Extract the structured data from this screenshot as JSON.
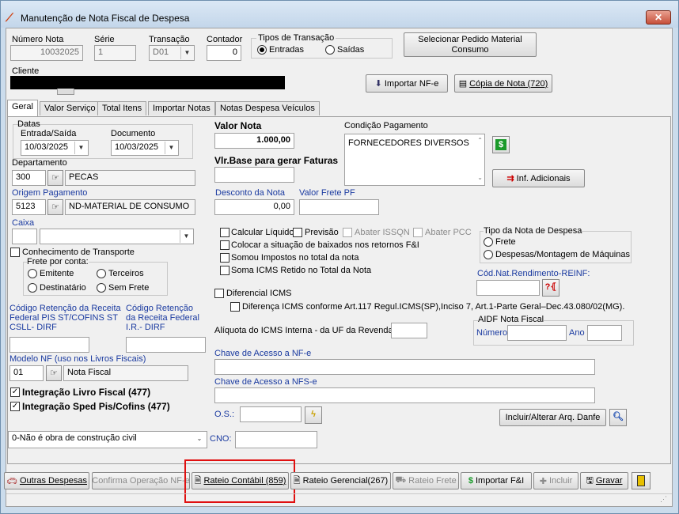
{
  "window": {
    "title": "Manutenção de Nota Fiscal de Despesa",
    "close": "✕"
  },
  "header": {
    "numero_nota_label": "Número Nota",
    "numero_nota": "10032025",
    "serie_label": "Série",
    "serie": "1",
    "transacao_label": "Transação",
    "transacao": "D01",
    "contador_label": "Contador",
    "contador": "0",
    "tipos_label": "Tipos de Transação",
    "entradas": "Entradas",
    "saidas": "Saídas",
    "selecionar_pedido": "Selecionar Pedido Material Consumo",
    "cliente_label": "Cliente",
    "importar_nfe": "Importar NF-e",
    "copia_nota": "Cópia de Nota (720)"
  },
  "tabs": [
    "Geral",
    "Valor Serviço",
    "Total Itens",
    "Importar Notas",
    "Notas Despesa Veículos"
  ],
  "geral": {
    "datas_label": "Datas",
    "entrada_saida_label": "Entrada/Saída",
    "entrada_saida": "10/03/2025",
    "documento_label": "Documento",
    "documento": "10/03/2025",
    "departamento_label": "Departamento",
    "departamento_cod": "300",
    "departamento_desc": "PECAS",
    "origem_label": "Origem Pagamento",
    "origem_cod": "5123",
    "origem_desc": "ND-MATERIAL DE CONSUMO",
    "caixa_label": "Caixa",
    "conhecimento_label": "Conhecimento de Transporte",
    "frete_conta_label": "Frete por conta:",
    "emitente": "Emitente",
    "terceiros": "Terceiros",
    "destinatario": "Destinatário",
    "sem_frete": "Sem Frete",
    "cod_ret_pis_label": "Código Retenção da Receita Federal PIS ST/COFINS ST CSLL- DIRF",
    "cod_ret_ir_label": "Código Retenção da Receita Federal I.R.- DIRF",
    "modelo_nf_label": "Modelo NF (uso nos Livros Fiscais)",
    "modelo_nf_cod": "01",
    "modelo_nf_desc": "Nota Fiscal",
    "integracao_livro": "Integração Livro Fiscal (477)",
    "integracao_sped": "Integração Sped Pis/Cofins (477)",
    "obra_select": "0-Não é obra de construção civil",
    "cno_label": "CNO:",
    "valor_nota_label": "Valor Nota",
    "valor_nota": "1.000,00",
    "vlr_base_label": "Vlr.Base para gerar Faturas",
    "desconto_label": "Desconto da Nota",
    "desconto": "0,00",
    "valor_frete_label": "Valor Frete PF",
    "condicao_label": "Condição Pagamento",
    "condicao": "FORNECEDORES DIVERSOS",
    "inf_adicionais": "Inf. Adicionais",
    "calcular_liquido": "Calcular Líquido",
    "previsao": "Previsão",
    "abater_issqn": "Abater ISSQN",
    "abater_pcc": "Abater PCC",
    "colocar_situacao": "Colocar a situação de baixados nos retornos F&I",
    "somou_impostos": "Somou Impostos no total da nota",
    "soma_icms": "Soma ICMS Retido no Total da Nota",
    "tipo_nota_label": "Tipo da Nota de Despesa",
    "frete": "Frete",
    "despesas_montagem": "Despesas/Montagem de Máquinas",
    "cod_nat_label": "Cód.Nat.Rendimento-REINF:",
    "diferencial_icms": "Diferencial ICMS",
    "diferenca_icms": "Diferença ICMS conforme Art.117 Regul.ICMS(SP),Inciso 7, Art.1-Parte Geral–Dec.43.080/02(MG).",
    "aliquota_label": "Alíquota do ICMS Interna - da UF da Revenda",
    "aidf_label": "AIDF Nota Fiscal",
    "numero_label": "Número",
    "ano_label": "Ano",
    "chave_nfe_label": "Chave de Acesso a NF-e",
    "chave_nfse_label": "Chave de Acesso a NFS-e",
    "os_label": "O.S.:",
    "incluir_danfe": "Incluir/Alterar Arq. Danfe"
  },
  "footer": {
    "outras_despesas": "Outras Despesas",
    "confirma_operacao": "Confirma Operação NF-e",
    "rateio_contabil": "Rateio Contábil (859)",
    "rateio_gerencial": "Rateio Gerencial(267)",
    "rateio_frete": "Rateio Frete",
    "importar_fi": "Importar F&I",
    "incluir": "Incluir",
    "gravar": "Gravar"
  }
}
